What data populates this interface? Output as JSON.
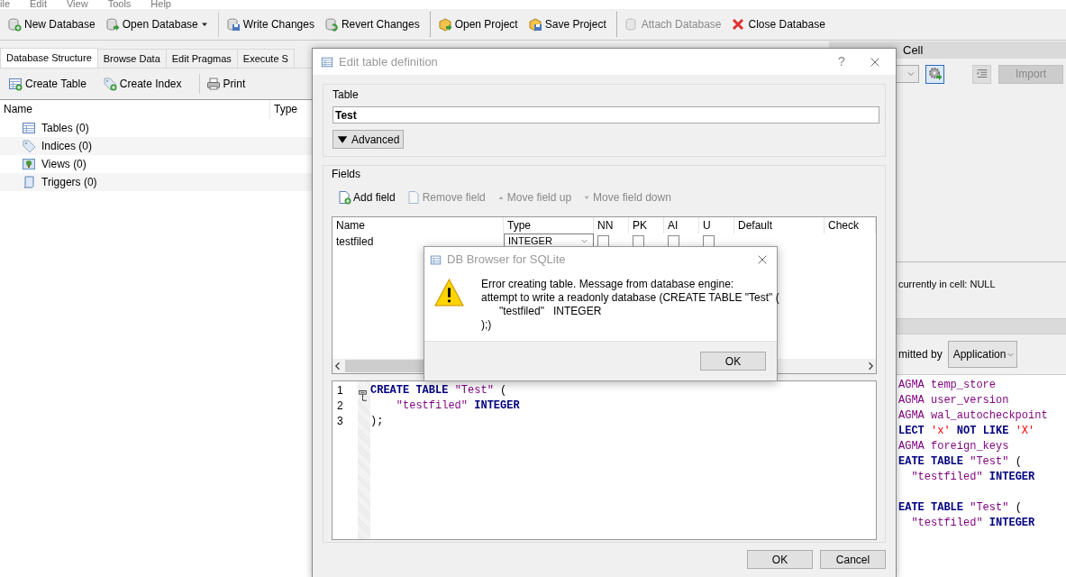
{
  "menu": [
    "ile",
    "Edit",
    "View",
    "Tools",
    "Help"
  ],
  "toolbar": [
    [
      {
        "label": "New Database",
        "disabled": false,
        "menu_button": false
      },
      {
        "label": "Open Database",
        "disabled": false,
        "menu_button": true
      }
    ],
    [
      {
        "label": "Write Changes",
        "disabled": false,
        "menu_button": false
      },
      {
        "label": "Revert Changes",
        "disabled": false,
        "menu_button": false
      }
    ],
    [
      {
        "label": "Open Project",
        "disabled": false,
        "menu_button": false
      },
      {
        "label": "Save Project",
        "disabled": false,
        "menu_button": false
      }
    ],
    [
      {
        "label": "Attach Database",
        "disabled": true,
        "menu_button": false
      },
      {
        "label": "Close Database",
        "disabled": false,
        "menu_button": false
      }
    ]
  ],
  "tabs": [
    {
      "label": "Database Structure",
      "selected": true
    },
    {
      "label": "Browse Data",
      "selected": false
    },
    {
      "label": "Edit Pragmas",
      "selected": false
    },
    {
      "label": "Execute S",
      "selected": false
    }
  ],
  "structure_toolbar": [
    "Create Table",
    "Create Index",
    "Print"
  ],
  "tree": {
    "columns": [
      "Name",
      "Type"
    ],
    "items": [
      {
        "label": "Tables (0)"
      },
      {
        "label": "Indices (0)"
      },
      {
        "label": "Views (0)"
      },
      {
        "label": "Triggers (0)"
      }
    ]
  },
  "edit_cell": {
    "title": "Cell",
    "import_button": {
      "label": "Import",
      "disabled": true
    },
    "status": "currently in cell: NULL"
  },
  "sql_log": {
    "submitted_label": "mitted by",
    "submitted_by": "Application",
    "lines": [
      {
        "blank_line_before": false,
        "tokens": [
          {
            "kind": "identifier",
            "text": "AGMA temp_store"
          }
        ]
      },
      {
        "blank_line_before": false,
        "tokens": [
          {
            "kind": "identifier",
            "text": "AGMA user_version"
          }
        ]
      },
      {
        "blank_line_before": false,
        "tokens": [
          {
            "kind": "identifier",
            "text": "AGMA wal_autocheckpoint"
          }
        ]
      },
      {
        "blank_line_before": false,
        "tokens": [
          {
            "kind": "keyword",
            "text": "LECT "
          },
          {
            "kind": "string",
            "text": "'x'"
          },
          {
            "kind": "keyword",
            "text": " NOT LIKE "
          },
          {
            "kind": "string",
            "text": "'X'"
          }
        ]
      },
      {
        "blank_line_before": false,
        "tokens": [
          {
            "kind": "identifier",
            "text": "AGMA foreign_keys"
          }
        ]
      },
      {
        "blank_line_before": false,
        "tokens": [
          {
            "kind": "keyword",
            "text": "EATE TABLE "
          },
          {
            "kind": "identifier",
            "text": "\"Test\""
          },
          {
            "kind": "plain",
            "text": " ("
          }
        ]
      },
      {
        "blank_line_before": false,
        "tokens": [
          {
            "kind": "identifier",
            "text": "  \"testfiled\""
          },
          {
            "kind": "keyword",
            "text": " INTEGER"
          }
        ]
      },
      {
        "blank_line_before": true,
        "tokens": [
          {
            "kind": "keyword",
            "text": "EATE TABLE "
          },
          {
            "kind": "identifier",
            "text": "\"Test\""
          },
          {
            "kind": "plain",
            "text": " ("
          }
        ]
      },
      {
        "blank_line_before": false,
        "tokens": [
          {
            "kind": "identifier",
            "text": "  \"testfiled\""
          },
          {
            "kind": "keyword",
            "text": " INTEGER"
          }
        ]
      }
    ]
  },
  "dialog": {
    "title": "Edit table definition",
    "help": "?",
    "table_group": "Table",
    "table_name": "Test",
    "advanced": "Advanced",
    "fields_group": "Fields",
    "field_actions": [
      {
        "label": "Add field",
        "disabled": false
      },
      {
        "label": "Remove field",
        "disabled": true
      },
      {
        "label": "Move field up",
        "disabled": true
      },
      {
        "label": "Move field down",
        "disabled": true
      }
    ],
    "columns": [
      "Name",
      "Type",
      "NN",
      "PK",
      "AI",
      "U",
      "Default",
      "Check"
    ],
    "fields": [
      {
        "name": "testfiled",
        "type": "INTEGER",
        "nn": false,
        "pk": false,
        "ai": false,
        "u": false
      }
    ],
    "sql": {
      "line_numbers": [
        "1",
        "2",
        "3"
      ],
      "lines": [
        [
          {
            "kind": "keyword",
            "text": "CREATE TABLE "
          },
          {
            "kind": "identifier",
            "text": "\"Test\""
          },
          {
            "kind": "plain",
            "text": " ("
          }
        ],
        [
          {
            "kind": "identifier",
            "text": "    \"testfiled\""
          },
          {
            "kind": "keyword",
            "text": " INTEGER"
          }
        ],
        [
          {
            "kind": "plain",
            "text": ");"
          }
        ]
      ]
    },
    "buttons": [
      "OK",
      "Cancel"
    ]
  },
  "message_box": {
    "title": "DB Browser for SQLite",
    "message": "Error creating table. Message from database engine:\nattempt to write a readonly database (CREATE TABLE \"Test\" (\n\t\"testfiled\"\tINTEGER\n);)",
    "button": "OK"
  }
}
